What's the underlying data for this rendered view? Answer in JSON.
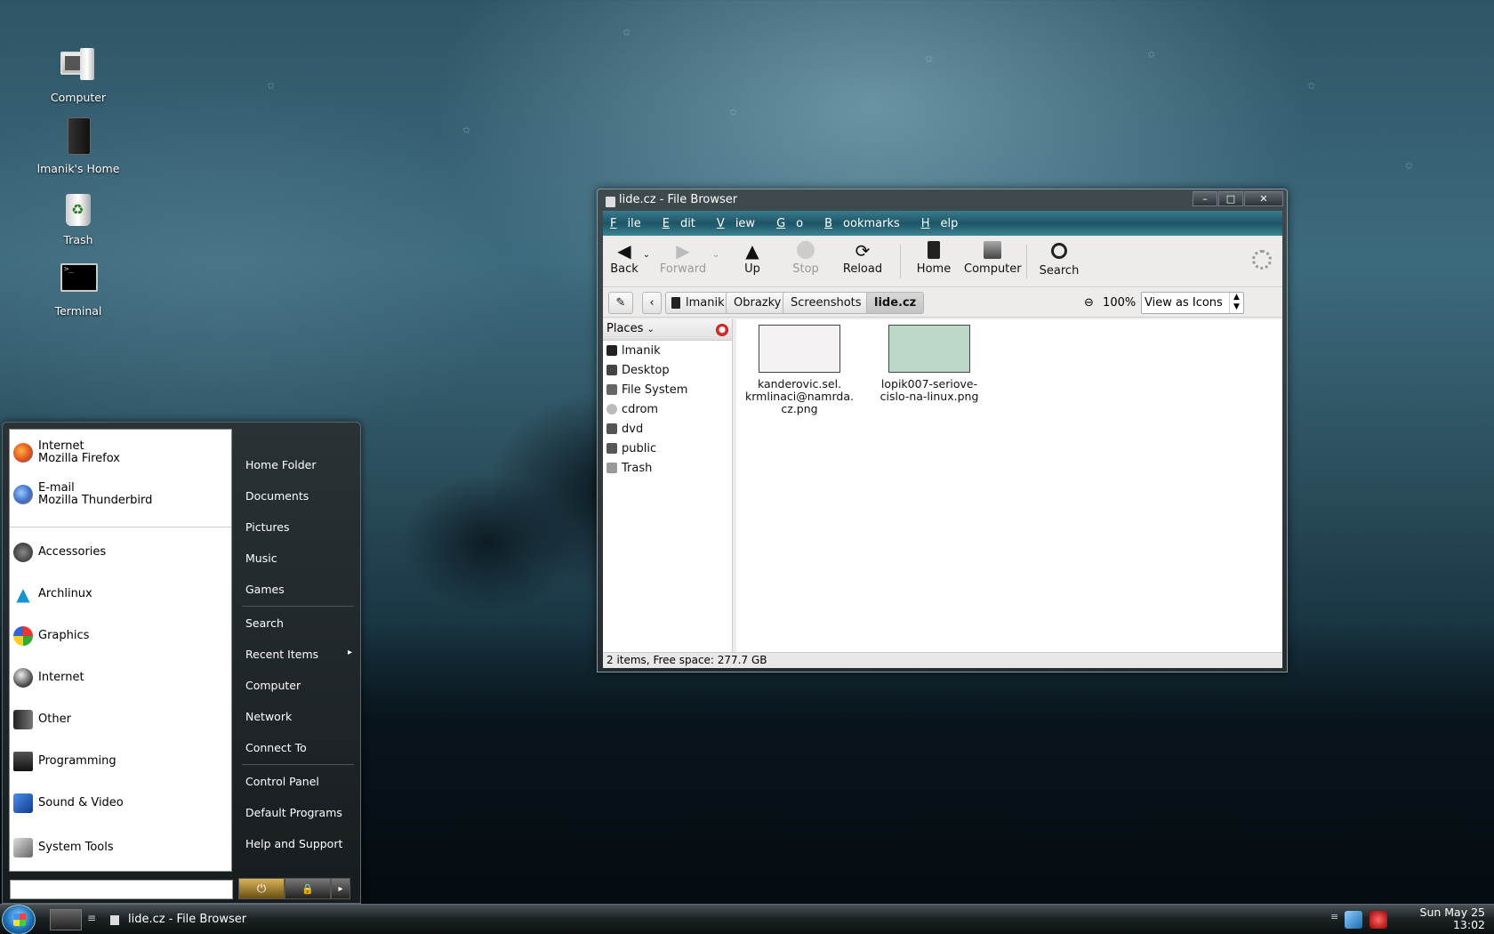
{
  "desktop": {
    "icons": [
      {
        "label": "Computer"
      },
      {
        "label": "lmanik's Home"
      },
      {
        "label": "Trash"
      },
      {
        "label": "Terminal"
      }
    ],
    "terminal_prompt": ">_"
  },
  "start_menu": {
    "pinned": [
      {
        "title": "Internet",
        "subtitle": "Mozilla Firefox",
        "icon": "firefox-icon"
      },
      {
        "title": "E-mail",
        "subtitle": "Mozilla Thunderbird",
        "icon": "thunderbird-icon"
      }
    ],
    "categories": [
      {
        "label": "Accessories",
        "icon": "accessories-icon"
      },
      {
        "label": "Archlinux",
        "icon": "archlinux-icon"
      },
      {
        "label": "Graphics",
        "icon": "graphics-icon"
      },
      {
        "label": "Internet",
        "icon": "globe-icon"
      },
      {
        "label": "Other",
        "icon": "other-icon"
      },
      {
        "label": "Programming",
        "icon": "programming-icon"
      },
      {
        "label": "Sound & Video",
        "icon": "clapperboard-icon"
      },
      {
        "label": "System Tools",
        "icon": "tools-icon"
      }
    ],
    "links": [
      {
        "label": "Home Folder"
      },
      {
        "label": "Documents"
      },
      {
        "label": "Pictures"
      },
      {
        "label": "Music"
      },
      {
        "label": "Games"
      },
      {
        "label": "Search"
      },
      {
        "label": "Recent Items",
        "arrow": "▸"
      },
      {
        "label": "Computer"
      },
      {
        "label": "Network"
      },
      {
        "label": "Connect To"
      },
      {
        "label": "Control Panel"
      },
      {
        "label": "Default Programs"
      },
      {
        "label": "Help and Support"
      }
    ],
    "search_value": "",
    "buttons": {
      "power": "⏻",
      "lock": "🔒",
      "more": "▸"
    }
  },
  "window": {
    "title": "lide.cz - File Browser",
    "controls": {
      "minimize": "–",
      "maximize": "□",
      "close": "✕"
    },
    "menu": [
      {
        "key": "F",
        "rest": "ile"
      },
      {
        "key": "E",
        "rest": "dit"
      },
      {
        "key": "V",
        "rest": "iew"
      },
      {
        "key": "G",
        "rest": "o"
      },
      {
        "key": "B",
        "rest": "ookmarks"
      },
      {
        "key": "H",
        "rest": "elp"
      }
    ],
    "toolbar": {
      "back": "Back",
      "forward": "Forward",
      "up": "Up",
      "stop": "Stop",
      "reload": "Reload",
      "home": "Home",
      "computer": "Computer",
      "search": "Search"
    },
    "breadcrumbs": [
      "lmanik",
      "Obrazky",
      "Screenshots",
      "lide.cz"
    ],
    "zoom_level": "100%",
    "view_mode": "View as Icons",
    "places_header": "Places",
    "places": [
      {
        "label": "lmanik",
        "icon": "home-icon"
      },
      {
        "label": "Desktop",
        "icon": "desktop-icon"
      },
      {
        "label": "File System",
        "icon": "drive-icon"
      },
      {
        "label": "cdrom",
        "icon": "cdrom-icon"
      },
      {
        "label": "dvd",
        "icon": "dvd-icon"
      },
      {
        "label": "public",
        "icon": "drive-icon"
      },
      {
        "label": "Trash",
        "icon": "trash-icon"
      }
    ],
    "files": [
      {
        "name_lines": [
          "kanderovic.sel.",
          "krmlinaci@namrda.",
          "cz.png"
        ],
        "thumb_color": "#f4f2f2"
      },
      {
        "name_lines": [
          "lopik007-seriove-",
          "cislo-na-linux.png"
        ],
        "thumb_color": "#bcd8c8"
      }
    ],
    "status": "2 items, Free space: 277.7 GB"
  },
  "taskbar": {
    "task_label": "lide.cz - File Browser",
    "clock_date": "Sun May 25",
    "clock_time": "13:02"
  }
}
